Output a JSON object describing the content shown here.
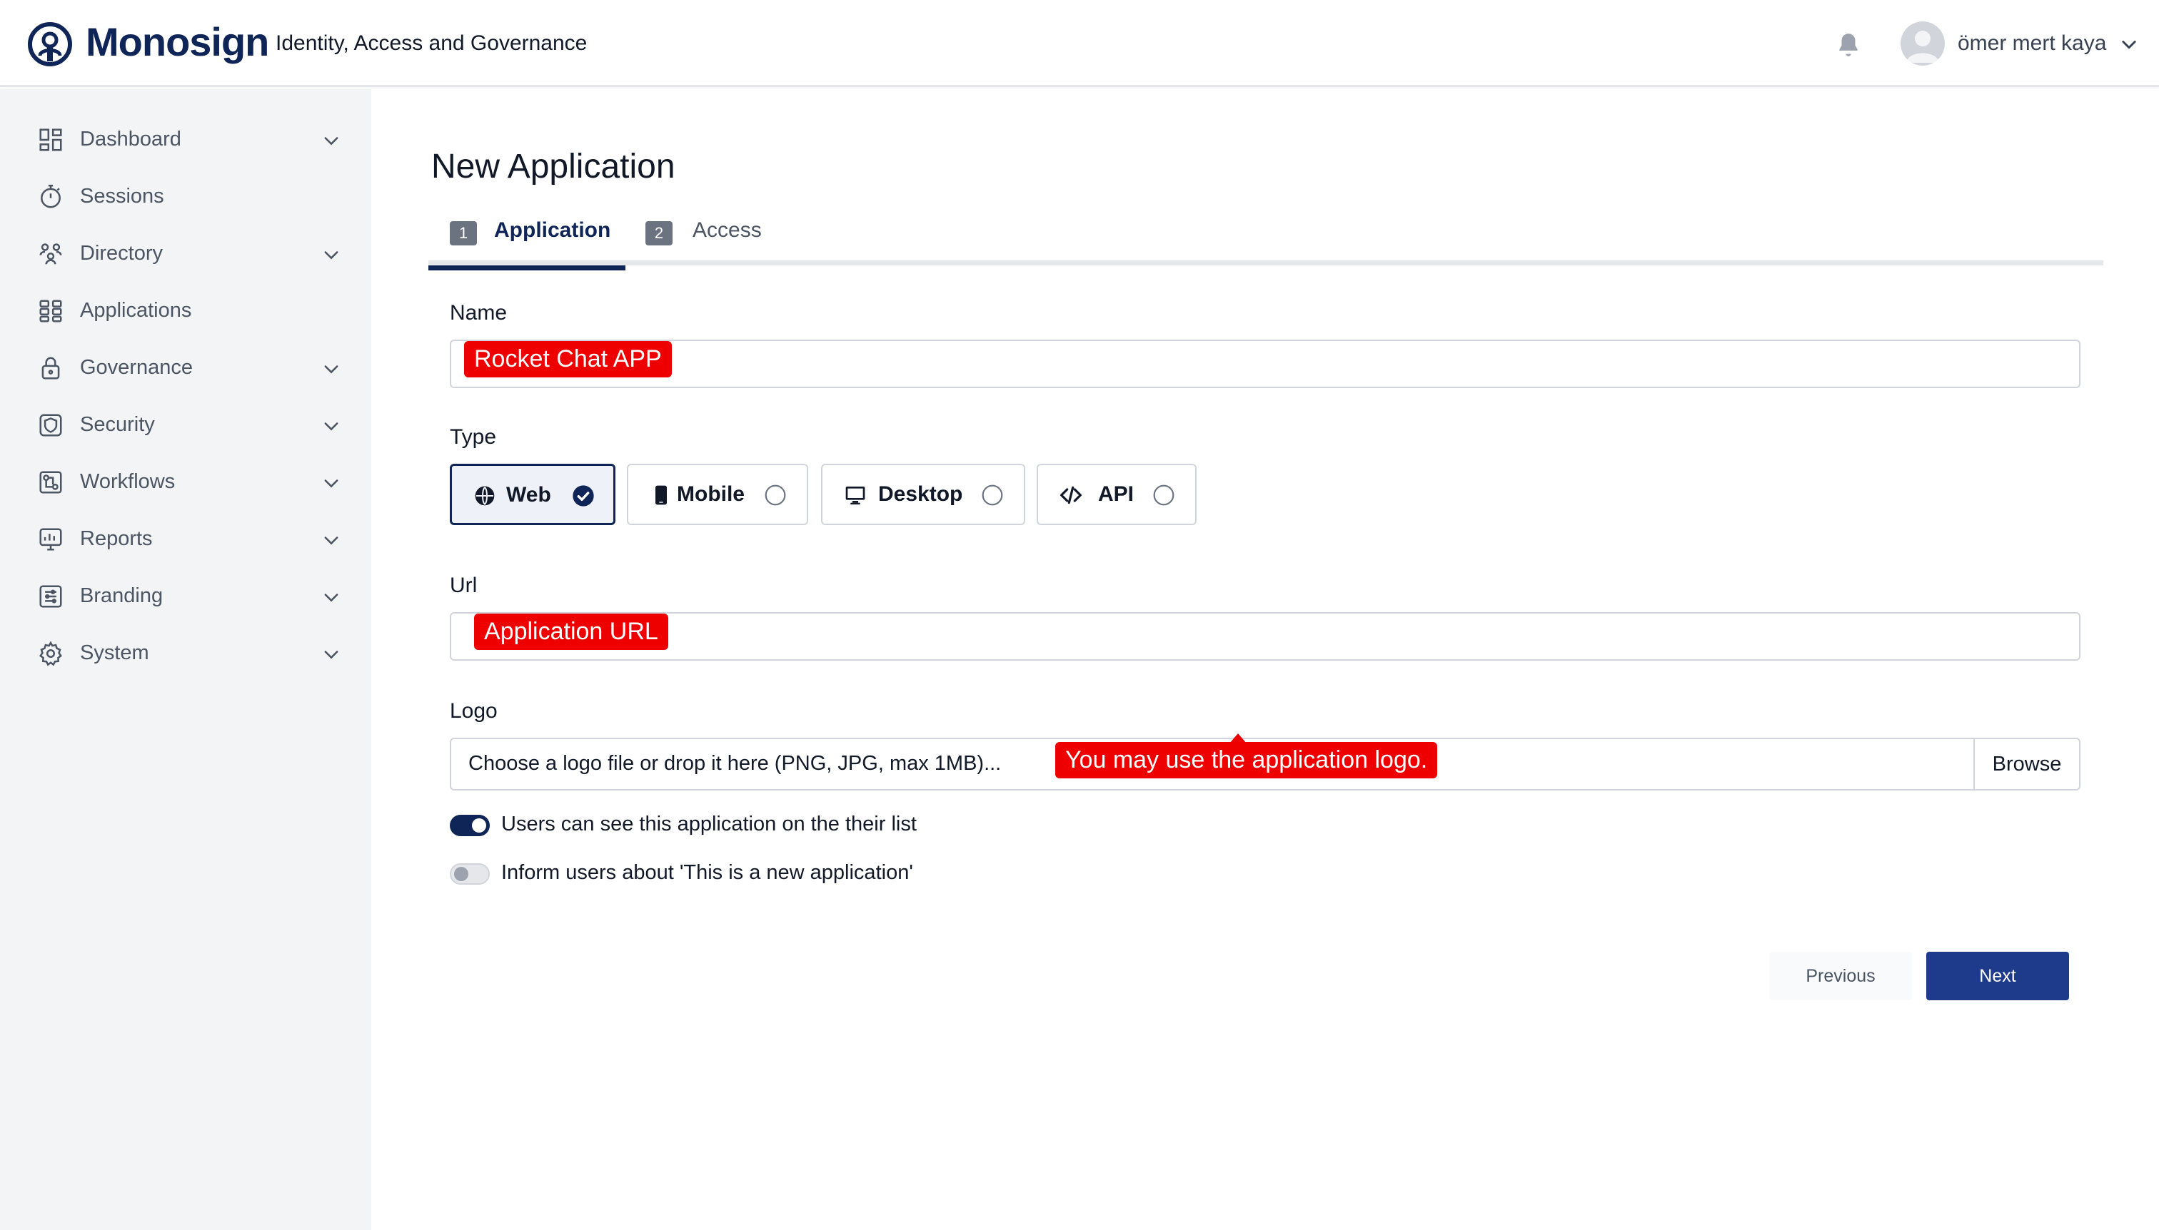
{
  "header": {
    "brand": "Monosign",
    "tagline": "Identity, Access and Governance",
    "user_name": "ömer mert kaya",
    "icons": {
      "logo": "monosign-logo-icon",
      "notifications": "bell-icon",
      "user_menu": "chevron-down-icon"
    }
  },
  "sidebar": {
    "items": [
      {
        "label": "Dashboard",
        "icon": "dashboard-icon",
        "expandable": true
      },
      {
        "label": "Sessions",
        "icon": "stopwatch-icon",
        "expandable": false
      },
      {
        "label": "Directory",
        "icon": "users-icon",
        "expandable": true
      },
      {
        "label": "Applications",
        "icon": "apps-grid-icon",
        "expandable": false
      },
      {
        "label": "Governance",
        "icon": "lock-icon",
        "expandable": true
      },
      {
        "label": "Security",
        "icon": "shield-icon",
        "expandable": true
      },
      {
        "label": "Workflows",
        "icon": "workflow-icon",
        "expandable": true
      },
      {
        "label": "Reports",
        "icon": "reports-icon",
        "expandable": true
      },
      {
        "label": "Branding",
        "icon": "branding-icon",
        "expandable": true
      },
      {
        "label": "System",
        "icon": "gear-icon",
        "expandable": true
      }
    ]
  },
  "main": {
    "title": "New Application",
    "tabs": [
      {
        "number": "1",
        "label": "Application",
        "active": true
      },
      {
        "number": "2",
        "label": "Access",
        "active": false
      }
    ],
    "name_label": "Name",
    "name_annotation": "Rocket Chat APP",
    "type_label": "Type",
    "types": [
      {
        "label": "Web",
        "icon": "globe-icon",
        "selected": true
      },
      {
        "label": "Mobile",
        "icon": "mobile-icon",
        "selected": false
      },
      {
        "label": "Desktop",
        "icon": "desktop-icon",
        "selected": false
      },
      {
        "label": "API",
        "icon": "code-icon",
        "selected": false
      }
    ],
    "url_label": "Url",
    "url_annotation": "Application URL",
    "logo_label": "Logo",
    "logo_placeholder": "Choose a logo file or drop it here (PNG, JPG, max 1MB)...",
    "browse_label": "Browse",
    "logo_annotation": "You may use the application logo.",
    "toggles": [
      {
        "label": "Users can see this application on the their list",
        "on": true
      },
      {
        "label": "Inform users about 'This is a new application'",
        "on": false
      }
    ],
    "buttons": {
      "previous": "Previous",
      "next": "Next"
    }
  },
  "colors": {
    "brand_navy": "#0f2557",
    "next_button": "#1e3a8a",
    "annotation_red": "#ef0000",
    "sidebar_bg": "#f3f4f6"
  }
}
